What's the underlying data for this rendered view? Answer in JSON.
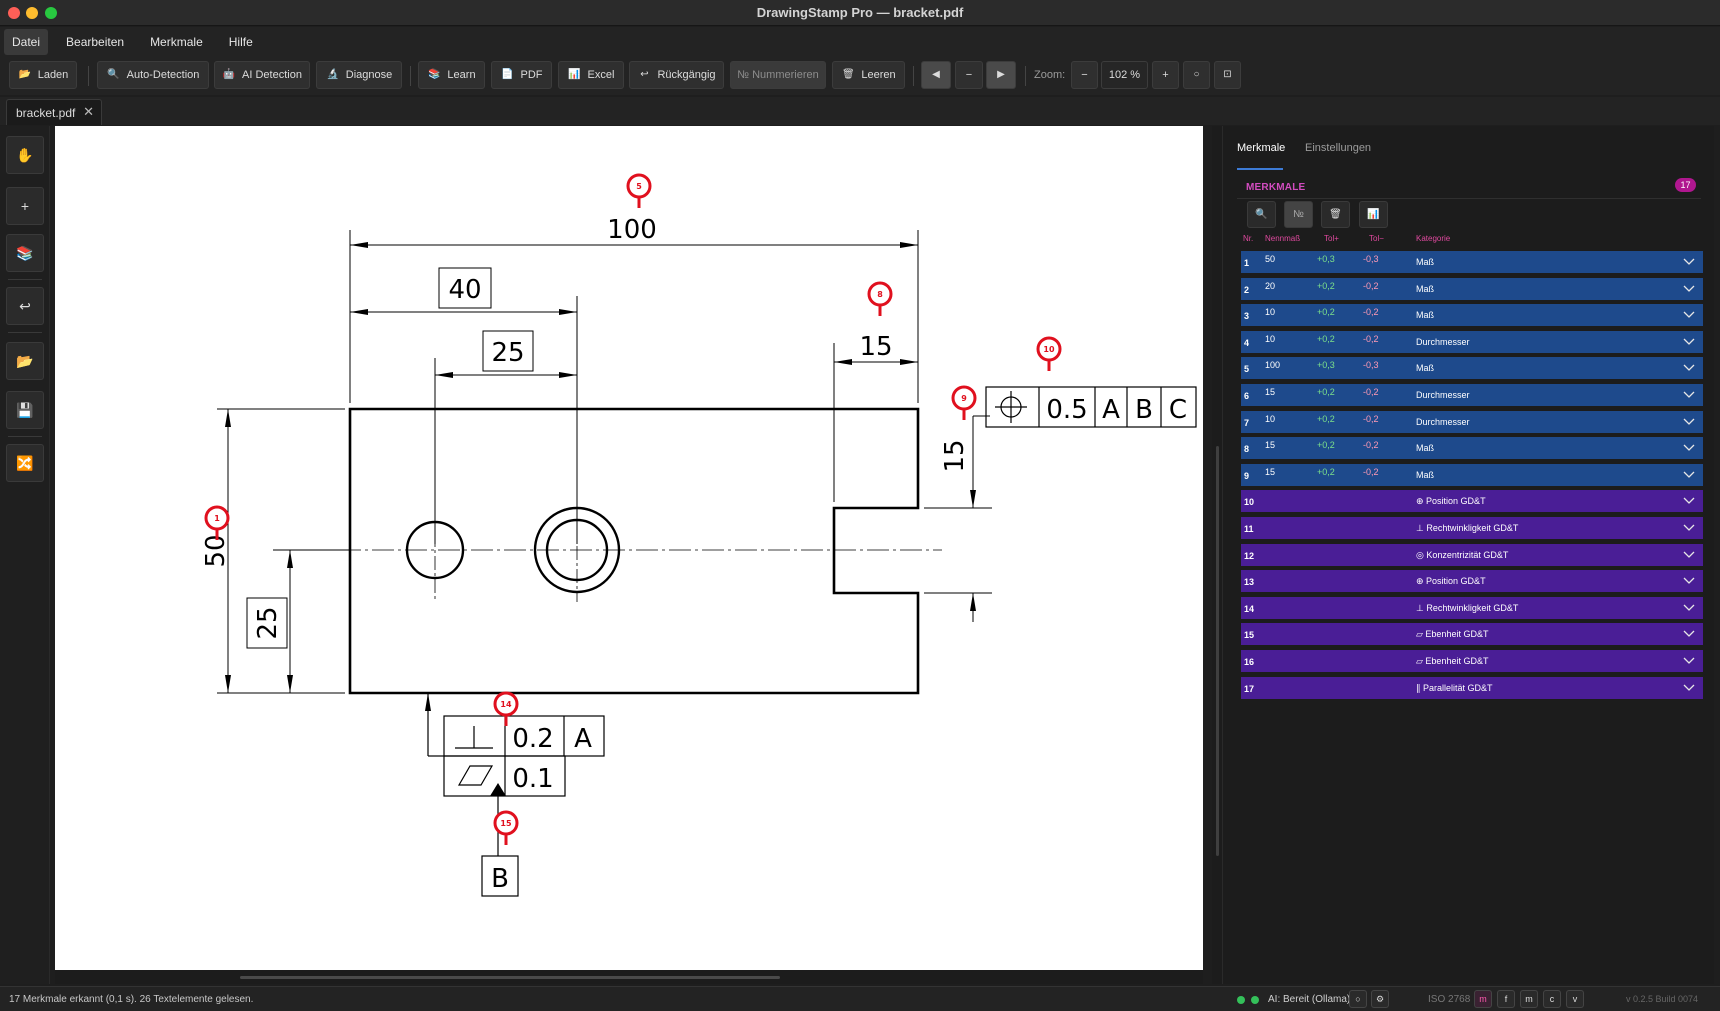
{
  "window": {
    "title": "DrawingStamp Pro — bracket.pdf"
  },
  "menu": [
    "Datei",
    "Bearbeiten",
    "Merkmale",
    "Hilfe"
  ],
  "toolbar": {
    "laden": "Laden",
    "auto_detection": "Auto-Detection",
    "ai_detection": "AI Detection",
    "diagnose": "Diagnose",
    "learn": "Learn",
    "pdf": "PDF",
    "excel": "Excel",
    "undo": "Rückgängig",
    "nummerieren": "№ Nummerieren",
    "leeren": "Leeren",
    "zoom_label": "Zoom:",
    "zoom_value": "102 %",
    "zoom_minus": "−",
    "zoom_plus": "+",
    "line_minus": "−"
  },
  "tab": {
    "filename": "bracket.pdf",
    "close": "✕"
  },
  "drawing": {
    "dims": {
      "d100": "100",
      "d40": "40",
      "d25": "25",
      "d15top": "15",
      "d15side": "15",
      "d50": "50",
      "d25left": "25"
    },
    "fcf_position": {
      "tol": "0.5",
      "a": "A",
      "b": "B",
      "c": "C"
    },
    "fcf_perp": {
      "tol": "0.2",
      "ref": "A"
    },
    "fcf_flat": {
      "tol": "0.1"
    },
    "datum_b": "B",
    "balloons": [
      {
        "n": "5"
      },
      {
        "n": "8"
      },
      {
        "n": "10"
      },
      {
        "n": "9"
      },
      {
        "n": "1"
      },
      {
        "n": "14"
      },
      {
        "n": "15"
      }
    ]
  },
  "panel": {
    "tabs": [
      "Merkmale",
      "Einstellungen"
    ],
    "header": "MERKMALE",
    "count": "17",
    "columns": [
      "Nr.",
      "Nennmaß",
      "Tol+",
      "Tol−",
      "Kategorie"
    ],
    "rows": [
      {
        "nr": "1",
        "nenn": "50",
        "tp": "+0,3",
        "tm": "-0,3",
        "kat": "Maß",
        "type": "dim"
      },
      {
        "nr": "2",
        "nenn": "20",
        "tp": "+0,2",
        "tm": "-0,2",
        "kat": "Maß",
        "type": "dim"
      },
      {
        "nr": "3",
        "nenn": "10",
        "tp": "+0,2",
        "tm": "-0,2",
        "kat": "Maß",
        "type": "dim"
      },
      {
        "nr": "4",
        "nenn": "10",
        "tp": "+0,2",
        "tm": "-0,2",
        "kat": "Durchmesser",
        "type": "dim"
      },
      {
        "nr": "5",
        "nenn": "100",
        "tp": "+0,3",
        "tm": "-0,3",
        "kat": "Maß",
        "type": "dim"
      },
      {
        "nr": "6",
        "nenn": "15",
        "tp": "+0,2",
        "tm": "-0,2",
        "kat": "Durchmesser",
        "type": "dim"
      },
      {
        "nr": "7",
        "nenn": "10",
        "tp": "+0,2",
        "tm": "-0,2",
        "kat": "Durchmesser",
        "type": "dim"
      },
      {
        "nr": "8",
        "nenn": "15",
        "tp": "+0,2",
        "tm": "-0,2",
        "kat": "Maß",
        "type": "dim"
      },
      {
        "nr": "9",
        "nenn": "15",
        "tp": "+0,2",
        "tm": "-0,2",
        "kat": "Maß",
        "type": "dim"
      },
      {
        "nr": "10",
        "nenn": "",
        "tp": "",
        "tm": "",
        "kat": "⊕ Position GD&T",
        "type": "gdt"
      },
      {
        "nr": "11",
        "nenn": "",
        "tp": "",
        "tm": "",
        "kat": "⊥ Rechtwinkligkeit GD&T",
        "type": "gdt"
      },
      {
        "nr": "12",
        "nenn": "",
        "tp": "",
        "tm": "",
        "kat": "◎ Konzentrizität GD&T",
        "type": "gdt"
      },
      {
        "nr": "13",
        "nenn": "",
        "tp": "",
        "tm": "",
        "kat": "⊕ Position GD&T",
        "type": "gdt"
      },
      {
        "nr": "14",
        "nenn": "",
        "tp": "",
        "tm": "",
        "kat": "⊥ Rechtwinkligkeit GD&T",
        "type": "gdt"
      },
      {
        "nr": "15",
        "nenn": "",
        "tp": "",
        "tm": "",
        "kat": "▱ Ebenheit GD&T",
        "type": "gdt"
      },
      {
        "nr": "16",
        "nenn": "",
        "tp": "",
        "tm": "",
        "kat": "▱ Ebenheit GD&T",
        "type": "gdt"
      },
      {
        "nr": "17",
        "nenn": "",
        "tp": "",
        "tm": "",
        "kat": "∥ Parallelität GD&T",
        "type": "gdt"
      }
    ]
  },
  "status": {
    "message": "17 Merkmale erkannt  (0,1 s).  26 Textelemente gelesen.",
    "ai": "AI: Bereit (Ollama)",
    "iso": "ISO 2768",
    "iso_buttons": [
      "m",
      "f",
      "m",
      "c",
      "v"
    ],
    "version": "v 0.2.5   Build 0074"
  },
  "colors": {
    "dim_row": "#1e4a8c",
    "gdt_row": "#4a1e96",
    "balloon": "#e0101e",
    "accent_pink": "#d34cc0"
  }
}
